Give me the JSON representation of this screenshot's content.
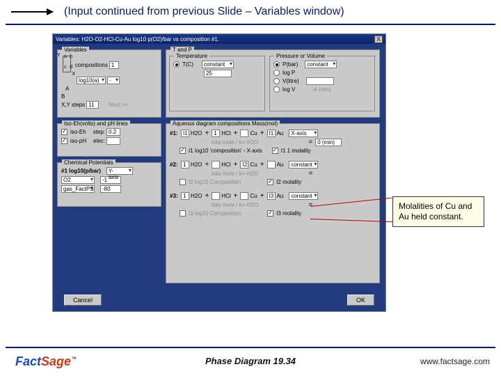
{
  "slide": {
    "header_text": "(Input continued from previous Slide – Variables window)",
    "footer_center": "Phase Diagram  19.34",
    "footer_url": "www.factsage.com",
    "logo_fact": "Fact",
    "logo_sage": "Sage",
    "logo_tm": "™"
  },
  "window": {
    "title": "Variables: H2O-O2-HCl-Cu-Au  log10 p(O2)/bar vs composition #1.",
    "close_glyph": "X"
  },
  "variables": {
    "legend": "Variables",
    "comp_label": "compositions",
    "comp_value": "1",
    "axis_y": "Y",
    "axis_x": "X",
    "corner_a": "a",
    "corner_b": "b",
    "corner_c": "c",
    "corner_d": "d",
    "point_A": "A",
    "point_B": "B",
    "log_label": "log10(a)",
    "log_sel": "-",
    "steps_label": "X,Y steps",
    "steps_value": "11",
    "next_btn": "Next >>"
  },
  "tp": {
    "legend": "T and P",
    "temp_legend": "Temperature",
    "t_label": "T(C)",
    "t_sel": "constant",
    "t_fixed": "25",
    "press_legend": "Pressure or Volume",
    "p_bar": "P(bar)",
    "p_sel": "constant",
    "log_p": "log P",
    "v_litre": "V(litre)",
    "v_val": "",
    "log_v": "log V",
    "neg4_min": "-4 (min)"
  },
  "iso": {
    "legend": "Iso-Eh(volts) and pH lines",
    "iso_eh": "iso-Eh",
    "iso_ph": "iso-pH",
    "step": "step:",
    "step_val1": "0.2",
    "step_val2": "",
    "elec": "elec:"
  },
  "chem": {
    "legend": "Chemical Potentials",
    "row_label": "#1 log10(p/bar)",
    "yaxis": "Y-axis",
    "sp1": "O2",
    "sp2": "gas_FactPS",
    "v1": "-1",
    "v2": "-80"
  },
  "aq": {
    "legend": "Aqueous diagram compositions Mass(mol)",
    "h2o": "H2O",
    "hcl": "HCl",
    "cu": "Cu",
    "au": "Au",
    "i1": "I1",
    "i2": "I2",
    "i3": "I3",
    "plus": "+",
    "eq": "=",
    "r1": {
      "h2o": "1",
      "hcl": "1",
      "cu": "",
      "au": "I1",
      "sel": "X-axis",
      "extra": "0 (min)"
    },
    "r2": {
      "h2o": "1",
      "hcl": "",
      "cu": "I2",
      "au": "",
      "sel": "constant"
    },
    "r3": {
      "h2o": "1",
      "hcl": "",
      "cu": "",
      "au": "I3",
      "sel": "constant"
    },
    "tot_line": "tota mole / k=-H2O",
    "cb1a": "I1 log10 'composition' - X-axis",
    "cb1b": "I1 1 molality",
    "cb2a": "I2 log10 Composition",
    "cb2b": "I2 molality",
    "cb3a": "I3 log10 Composition",
    "cb3b": "I3 molality",
    "row1_lbl": "#1:",
    "row2_lbl": "#2:",
    "row3_lbl": "#3:"
  },
  "buttons": {
    "cancel": "Cancel",
    "ok": "OK"
  },
  "callout": "Molalities of Cu and Au held constant."
}
